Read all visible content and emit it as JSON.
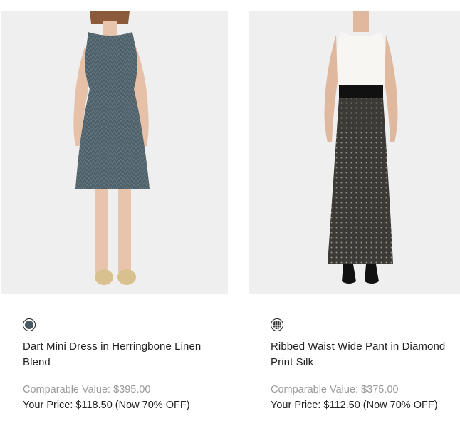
{
  "products": [
    {
      "title": "Dart Mini Dress in Herringbone Linen Blend",
      "comparable_value": "Comparable Value: $395.00",
      "your_price": "Your Price: $118.50 (Now 70% OFF)",
      "swatch_color": "#4a5a63"
    },
    {
      "title": "Ribbed Waist Wide Pant in Diamond Print Silk",
      "comparable_value": "Comparable Value: $375.00",
      "your_price": "Your Price: $112.50 (Now 70% OFF)",
      "swatch_color": "#3a3a3a"
    }
  ]
}
